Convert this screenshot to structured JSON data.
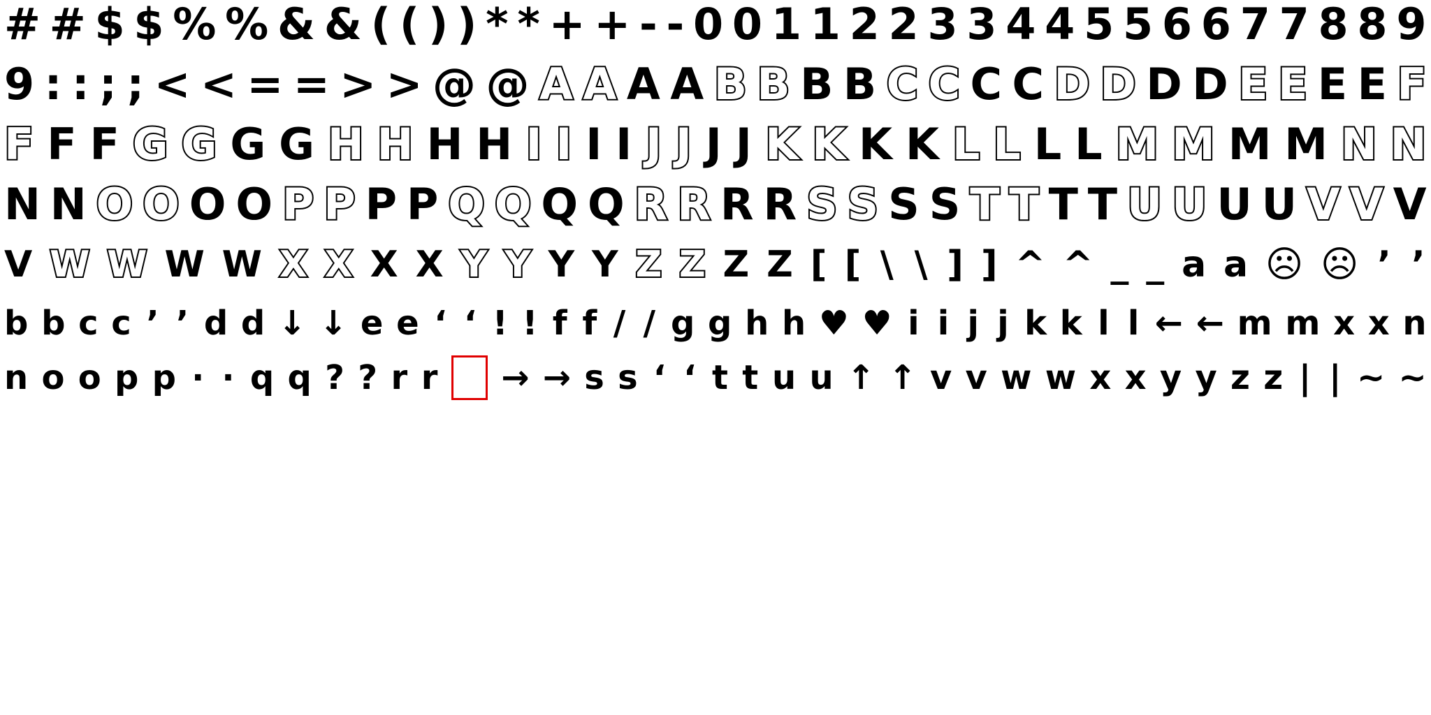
{
  "rows": [
    {
      "glyphs": [
        {
          "c": "#"
        },
        {
          "c": "#"
        },
        {
          "c": "$"
        },
        {
          "c": "$"
        },
        {
          "c": "%"
        },
        {
          "c": "%"
        },
        {
          "c": "&"
        },
        {
          "c": "&"
        },
        {
          "c": "("
        },
        {
          "c": "("
        },
        {
          "c": ")"
        },
        {
          "c": ")"
        },
        {
          "c": "*"
        },
        {
          "c": "*"
        },
        {
          "c": "+"
        },
        {
          "c": "+"
        },
        {
          "c": "-"
        },
        {
          "c": "-"
        },
        {
          "c": "0"
        },
        {
          "c": "0"
        },
        {
          "c": "1"
        },
        {
          "c": "1"
        },
        {
          "c": "2"
        },
        {
          "c": "2"
        },
        {
          "c": "3"
        },
        {
          "c": "3"
        },
        {
          "c": "4"
        },
        {
          "c": "4"
        },
        {
          "c": "5"
        },
        {
          "c": "5"
        },
        {
          "c": "6"
        },
        {
          "c": "6"
        },
        {
          "c": "7"
        },
        {
          "c": "7"
        },
        {
          "c": "8"
        },
        {
          "c": "8"
        },
        {
          "c": "9"
        }
      ]
    },
    {
      "glyphs": [
        {
          "c": "9"
        },
        {
          "c": ":"
        },
        {
          "c": ":"
        },
        {
          "c": ";"
        },
        {
          "c": ";"
        },
        {
          "c": "<"
        },
        {
          "c": "<"
        },
        {
          "c": "="
        },
        {
          "c": "="
        },
        {
          "c": ">"
        },
        {
          "c": ">"
        },
        {
          "c": "@"
        },
        {
          "c": "@"
        },
        {
          "c": "A",
          "o": 1
        },
        {
          "c": "A",
          "o": 1
        },
        {
          "c": "A"
        },
        {
          "c": "A"
        },
        {
          "c": "B",
          "o": 1
        },
        {
          "c": "B",
          "o": 1
        },
        {
          "c": "B"
        },
        {
          "c": "B"
        },
        {
          "c": "C",
          "o": 1
        },
        {
          "c": "C",
          "o": 1
        },
        {
          "c": "C"
        },
        {
          "c": "C"
        },
        {
          "c": "D",
          "o": 1
        },
        {
          "c": "D",
          "o": 1
        },
        {
          "c": "D"
        },
        {
          "c": "D"
        },
        {
          "c": "E",
          "o": 1
        },
        {
          "c": "E",
          "o": 1
        },
        {
          "c": "E"
        },
        {
          "c": "E"
        },
        {
          "c": "F",
          "o": 1
        }
      ]
    },
    {
      "glyphs": [
        {
          "c": "F",
          "o": 1
        },
        {
          "c": "F"
        },
        {
          "c": "F"
        },
        {
          "c": "G",
          "o": 1
        },
        {
          "c": "G",
          "o": 1
        },
        {
          "c": "G"
        },
        {
          "c": "G"
        },
        {
          "c": "H",
          "o": 1
        },
        {
          "c": "H",
          "o": 1
        },
        {
          "c": "H"
        },
        {
          "c": "H"
        },
        {
          "c": "I",
          "o": 1
        },
        {
          "c": "I",
          "o": 1
        },
        {
          "c": "I"
        },
        {
          "c": "I"
        },
        {
          "c": "J",
          "o": 1
        },
        {
          "c": "J",
          "o": 1
        },
        {
          "c": "J"
        },
        {
          "c": "J"
        },
        {
          "c": "K",
          "o": 1
        },
        {
          "c": "K",
          "o": 1
        },
        {
          "c": "K"
        },
        {
          "c": "K"
        },
        {
          "c": "L",
          "o": 1
        },
        {
          "c": "L",
          "o": 1
        },
        {
          "c": "L"
        },
        {
          "c": "L"
        },
        {
          "c": "M",
          "o": 1
        },
        {
          "c": "M",
          "o": 1
        },
        {
          "c": "M"
        },
        {
          "c": "M"
        },
        {
          "c": "N",
          "o": 1
        },
        {
          "c": "N",
          "o": 1
        }
      ]
    },
    {
      "glyphs": [
        {
          "c": "N"
        },
        {
          "c": "N"
        },
        {
          "c": "O",
          "o": 1
        },
        {
          "c": "O",
          "o": 1
        },
        {
          "c": "O"
        },
        {
          "c": "O"
        },
        {
          "c": "P",
          "o": 1
        },
        {
          "c": "P",
          "o": 1
        },
        {
          "c": "P"
        },
        {
          "c": "P"
        },
        {
          "c": "Q",
          "o": 1
        },
        {
          "c": "Q",
          "o": 1
        },
        {
          "c": "Q"
        },
        {
          "c": "Q"
        },
        {
          "c": "R",
          "o": 1
        },
        {
          "c": "R",
          "o": 1
        },
        {
          "c": "R"
        },
        {
          "c": "R"
        },
        {
          "c": "S",
          "o": 1
        },
        {
          "c": "S",
          "o": 1
        },
        {
          "c": "S"
        },
        {
          "c": "S"
        },
        {
          "c": "T",
          "o": 1
        },
        {
          "c": "T",
          "o": 1
        },
        {
          "c": "T"
        },
        {
          "c": "T"
        },
        {
          "c": "U",
          "o": 1
        },
        {
          "c": "U",
          "o": 1
        },
        {
          "c": "U"
        },
        {
          "c": "U"
        },
        {
          "c": "V",
          "o": 1
        },
        {
          "c": "V",
          "o": 1
        },
        {
          "c": "V"
        }
      ]
    },
    {
      "glyphs": [
        {
          "c": "V"
        },
        {
          "c": "W",
          "o": 1
        },
        {
          "c": "W",
          "o": 1
        },
        {
          "c": "W"
        },
        {
          "c": "W"
        },
        {
          "c": "X",
          "o": 1
        },
        {
          "c": "X",
          "o": 1
        },
        {
          "c": "X"
        },
        {
          "c": "X"
        },
        {
          "c": "Y",
          "o": 1
        },
        {
          "c": "Y",
          "o": 1
        },
        {
          "c": "Y"
        },
        {
          "c": "Y"
        },
        {
          "c": "Z",
          "o": 1
        },
        {
          "c": "Z",
          "o": 1
        },
        {
          "c": "Z"
        },
        {
          "c": "Z"
        },
        {
          "c": "["
        },
        {
          "c": "["
        },
        {
          "c": "\\"
        },
        {
          "c": "\\"
        },
        {
          "c": "]"
        },
        {
          "c": "]"
        },
        {
          "c": "^"
        },
        {
          "c": "^"
        },
        {
          "c": "_"
        },
        {
          "c": "_"
        },
        {
          "c": "a"
        },
        {
          "c": "a"
        },
        {
          "c": "☹"
        },
        {
          "c": "☹"
        },
        {
          "c": "’"
        },
        {
          "c": "’"
        }
      ]
    },
    {
      "glyphs": [
        {
          "c": "b"
        },
        {
          "c": "b"
        },
        {
          "c": "c"
        },
        {
          "c": "c"
        },
        {
          "c": "’"
        },
        {
          "c": "’"
        },
        {
          "c": "d"
        },
        {
          "c": "d"
        },
        {
          "c": "↓"
        },
        {
          "c": "↓"
        },
        {
          "c": "e"
        },
        {
          "c": "e"
        },
        {
          "c": "‘"
        },
        {
          "c": "‘"
        },
        {
          "c": "!"
        },
        {
          "c": "!"
        },
        {
          "c": "f"
        },
        {
          "c": "f"
        },
        {
          "c": "/"
        },
        {
          "c": "/"
        },
        {
          "c": "g"
        },
        {
          "c": "g"
        },
        {
          "c": "h"
        },
        {
          "c": "h"
        },
        {
          "c": "♥"
        },
        {
          "c": "♥"
        },
        {
          "c": "i"
        },
        {
          "c": "i"
        },
        {
          "c": "j"
        },
        {
          "c": "j"
        },
        {
          "c": "k"
        },
        {
          "c": "k"
        },
        {
          "c": "l"
        },
        {
          "c": "l"
        },
        {
          "c": "←"
        },
        {
          "c": "←"
        },
        {
          "c": "m"
        },
        {
          "c": "m"
        },
        {
          "c": "x"
        },
        {
          "c": "x"
        },
        {
          "c": "n"
        }
      ]
    },
    {
      "glyphs": [
        {
          "c": "n"
        },
        {
          "c": "o"
        },
        {
          "c": "o"
        },
        {
          "c": "p"
        },
        {
          "c": "p"
        },
        {
          "c": "·"
        },
        {
          "c": "·"
        },
        {
          "c": "q"
        },
        {
          "c": "q"
        },
        {
          "c": "?"
        },
        {
          "c": "?"
        },
        {
          "c": "r"
        },
        {
          "c": "r"
        },
        {
          "c": "",
          "missing": 1
        },
        {
          "c": "→"
        },
        {
          "c": "→"
        },
        {
          "c": "s"
        },
        {
          "c": "s"
        },
        {
          "c": "‘"
        },
        {
          "c": "‘"
        },
        {
          "c": "t"
        },
        {
          "c": "t"
        },
        {
          "c": "u"
        },
        {
          "c": "u"
        },
        {
          "c": "↑"
        },
        {
          "c": "↑"
        },
        {
          "c": "v"
        },
        {
          "c": "v"
        },
        {
          "c": "w"
        },
        {
          "c": "w"
        },
        {
          "c": "x"
        },
        {
          "c": "x"
        },
        {
          "c": "y"
        },
        {
          "c": "y"
        },
        {
          "c": "z"
        },
        {
          "c": "z"
        },
        {
          "c": "|"
        },
        {
          "c": "|"
        },
        {
          "c": "~"
        },
        {
          "c": "~"
        }
      ]
    }
  ],
  "colors": {
    "ink": "#000000",
    "background": "#ffffff",
    "missing_box": "#e00000"
  }
}
